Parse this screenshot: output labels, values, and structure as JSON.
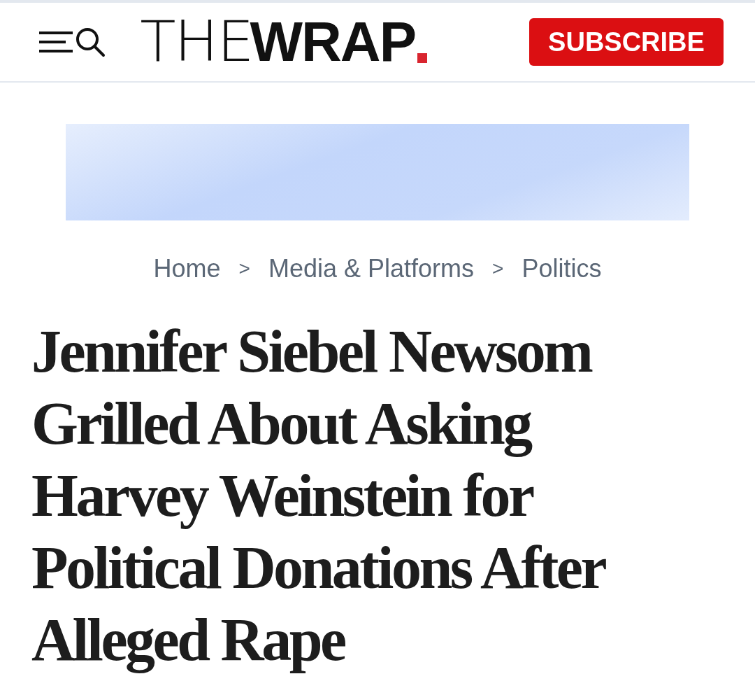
{
  "header": {
    "logo": {
      "light": "THE",
      "bold": "WRAP"
    },
    "subscribe_button": "SUBSCRIBE"
  },
  "breadcrumb": [
    "Home",
    "Media & Platforms",
    "Politics"
  ],
  "breadcrumb_separator": ">",
  "headline": "Jennifer Siebel Newsom Grilled About Asking Harvey Weinstein for Political Donations After Alleged Rape"
}
